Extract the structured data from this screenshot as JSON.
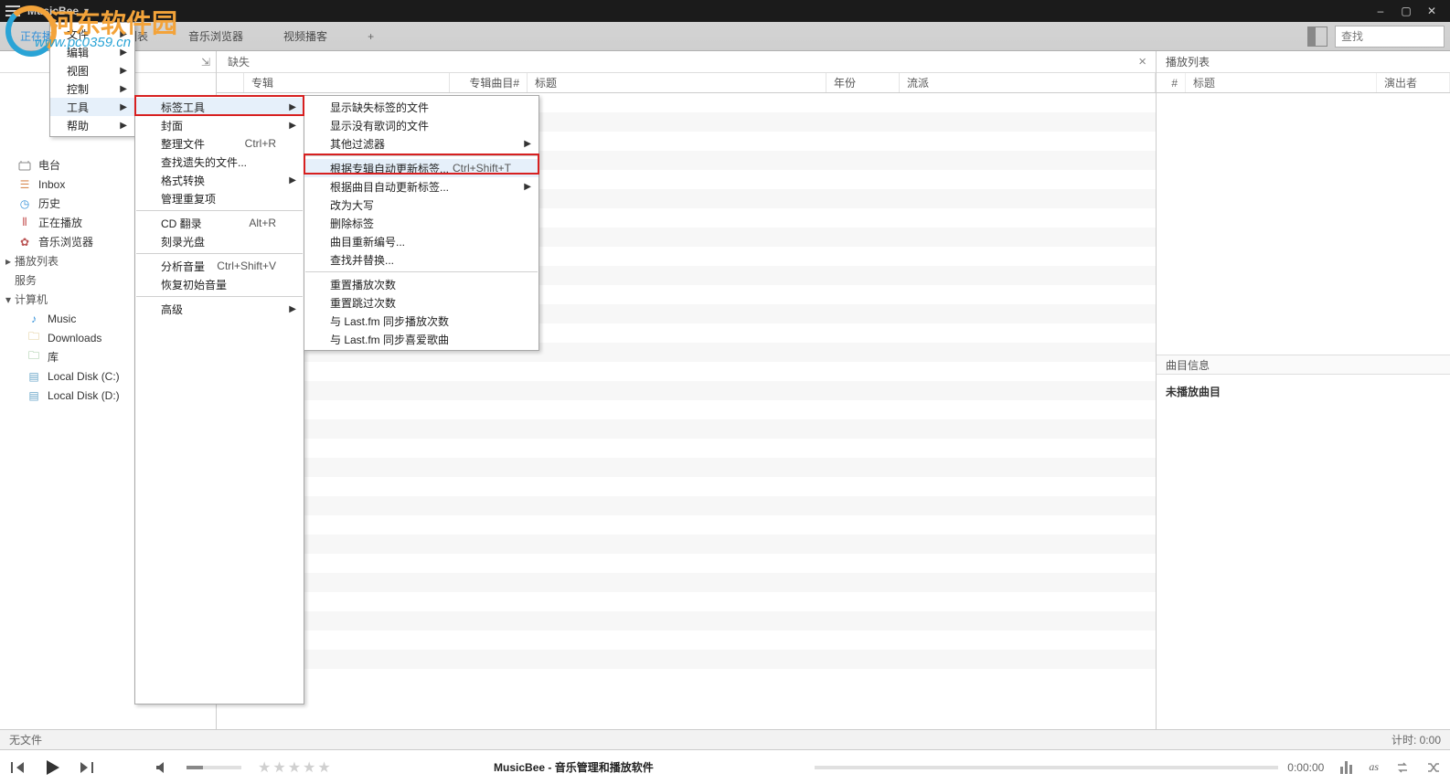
{
  "titlebar": {
    "app": "MusicBee"
  },
  "tabs": {
    "nowplaying": "正在播放",
    "playlist": "播放列表",
    "musicbrowser": "音乐浏览器",
    "videoplayer": "视频播客",
    "plus": "+"
  },
  "search": {
    "placeholder": "查找"
  },
  "sidebar": {
    "library": "电台",
    "inbox": "Inbox",
    "history": "历史",
    "nowplaying": "正在播放",
    "musicbrowser": "音乐浏览器",
    "playlists": "播放列表",
    "services": "服务",
    "computer": "计算机",
    "music": "Music",
    "downloads": "Downloads",
    "libraries": "库",
    "localc": "Local Disk (C:)",
    "locald": "Local Disk (D:)"
  },
  "subhead": {
    "missing": "缺失",
    "playlist_title": "播放列表"
  },
  "gridhead": {
    "album": "专辑",
    "trackno": "专辑曲目#",
    "title": "标题",
    "year": "年份",
    "genre": "流派"
  },
  "rpcols": {
    "no": "#",
    "title": "标题",
    "artist": "演出者"
  },
  "trackinfo": {
    "head": "曲目信息",
    "none": "未播放曲目"
  },
  "status": {
    "nofile": "无文件",
    "timer": "计时: 0:00"
  },
  "player": {
    "title": "MusicBee - 音乐管理和播放软件",
    "time": "0:00:00",
    "lastfm": "as"
  },
  "watermark": {
    "name": "河东软件园",
    "url": "www.pc0359.cn"
  },
  "menu1": {
    "file": "文件",
    "edit": "编辑",
    "view": "视图",
    "control": "控制",
    "tools": "工具",
    "help": "帮助"
  },
  "menu2": {
    "tagtools": "标签工具",
    "cover": "封面",
    "organise": "整理文件",
    "orgsc": "Ctrl+R",
    "findmissing": "查找遗失的文件...",
    "convert": "格式转换",
    "dup": "管理重复项",
    "cdrip": "CD 翻录",
    "cdripsc": "Alt+R",
    "burn": "刻录光盘",
    "analyse": "分析音量",
    "analysesc": "Ctrl+Shift+V",
    "restore": "恢复初始音量",
    "advanced": "高级"
  },
  "menu3": {
    "showmissing": "显示缺失标签的文件",
    "shownolyrics": "显示没有歌词的文件",
    "otherfilter": "其他过滤器",
    "autoalbum": "根据专辑自动更新标签...",
    "autoalbumsc": "Ctrl+Shift+T",
    "autotrack": "根据曲目自动更新标签...",
    "upper": "改为大写",
    "remove": "删除标签",
    "renumber": "曲目重新编号...",
    "findrep": "查找并替换...",
    "resetplay": "重置播放次数",
    "resetskip": "重置跳过次数",
    "synclastplay": "与 Last.fm 同步播放次数",
    "synclastlove": "与 Last.fm 同步喜爱歌曲"
  }
}
